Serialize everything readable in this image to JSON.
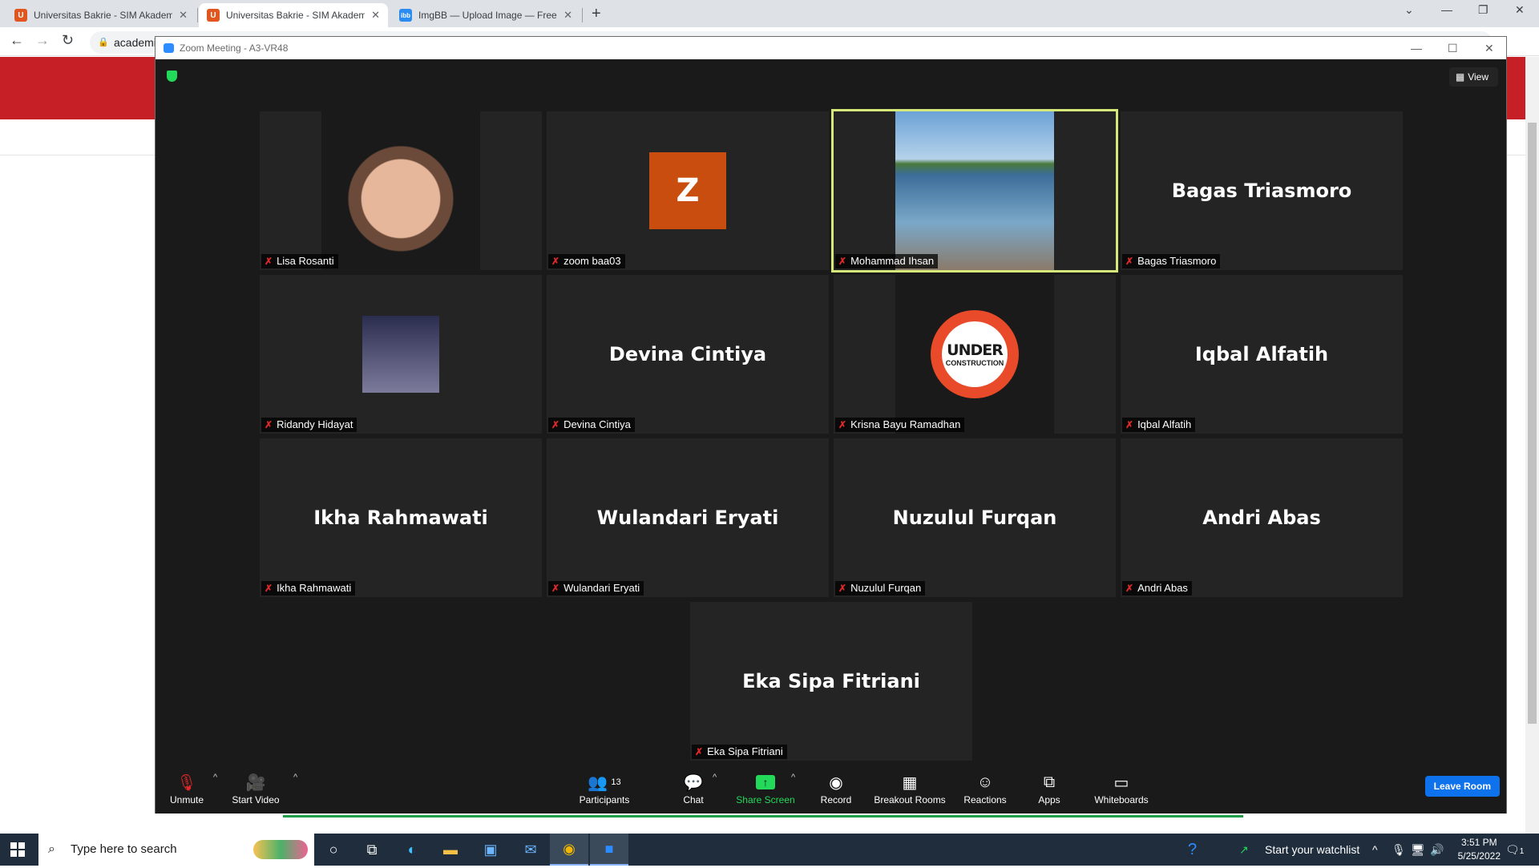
{
  "browser": {
    "tabs": [
      {
        "title": "Universitas Bakrie - SIM Akademik",
        "favicon": "U",
        "favicon_color": "#e0561e",
        "active": false
      },
      {
        "title": "Universitas Bakrie - SIM Akademik",
        "favicon": "U",
        "favicon_color": "#e0561e",
        "active": true
      },
      {
        "title": "ImgBB — Upload Image — Free Image Hosting",
        "favicon": "ibb",
        "favicon_color": "#2a8cf0",
        "active": false
      }
    ],
    "new_tab": "+",
    "address": "academi"
  },
  "zoom": {
    "window_title": "Zoom Meeting - A3-VR48",
    "view_label": "View",
    "participants": [
      {
        "name": "Lisa Rosanti",
        "display": "",
        "media": "photo-child"
      },
      {
        "name": "zoom baa03",
        "display": "",
        "media": "avatar",
        "avatar_letter": "Z"
      },
      {
        "name": "Mohammad Ihsan",
        "display": "",
        "media": "photo-lake",
        "active_speaker": true
      },
      {
        "name": "Bagas Triasmoro",
        "display": "Bagas Triasmoro",
        "media": "name"
      },
      {
        "name": "Ridandy Hidayat",
        "display": "",
        "media": "photo-purple"
      },
      {
        "name": "Devina Cintiya",
        "display": "Devina Cintiya",
        "media": "name"
      },
      {
        "name": "Krisna Bayu Ramadhan",
        "display": "",
        "media": "photo-under"
      },
      {
        "name": "Iqbal Alfatih",
        "display": "Iqbal Alfatih",
        "media": "name"
      },
      {
        "name": "Ikha Rahmawati",
        "display": "Ikha Rahmawati",
        "media": "name"
      },
      {
        "name": "Wulandari Eryati",
        "display": "Wulandari Eryati",
        "media": "name"
      },
      {
        "name": "Nuzulul Furqan",
        "display": "Nuzulul Furqan",
        "media": "name"
      },
      {
        "name": "Andri Abas",
        "display": "Andri Abas",
        "media": "name"
      },
      {
        "name": "Eka Sipa Fitriani",
        "display": "Eka Sipa Fitriani",
        "media": "name"
      }
    ],
    "under_construction": {
      "line1": "UNDER",
      "line2": "CONSTRUCTION"
    },
    "toolbar": {
      "unmute": "Unmute",
      "start_video": "Start Video",
      "participants": "Participants",
      "participants_count": "13",
      "chat": "Chat",
      "share_screen": "Share Screen",
      "record": "Record",
      "breakout_rooms": "Breakout Rooms",
      "reactions": "Reactions",
      "apps": "Apps",
      "whiteboards": "Whiteboards",
      "leave": "Leave Room"
    },
    "colors": {
      "active_speaker_border": "#d6e87a",
      "share_green": "#23d959",
      "leave_blue": "#0e72ed",
      "avatar_orange": "#c94d0e"
    }
  },
  "taskbar": {
    "search_placeholder": "Type here to search",
    "watchlist": "Start your watchlist",
    "time": "3:51 PM",
    "date": "5/25/2022",
    "notification_count": "1"
  }
}
